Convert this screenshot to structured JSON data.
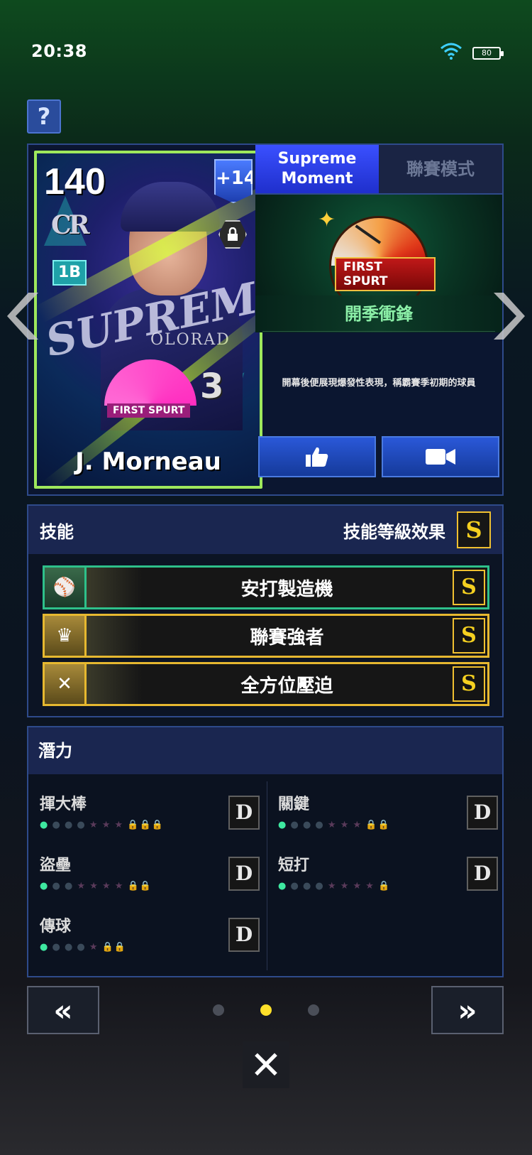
{
  "status_bar": {
    "time": "20:38",
    "battery": "80"
  },
  "help": {
    "label": "?"
  },
  "card": {
    "overall": "140",
    "plus": "+14",
    "team_logo": "CR",
    "position": "1B",
    "player_name": "J. Morneau",
    "jersey_text": "OLORAD",
    "jersey_number": "3",
    "overlay_word": "SUPREME",
    "theme_badge_label": "FIRST SPURT"
  },
  "tabs": [
    {
      "label": "Supreme\nMoment",
      "active": true
    },
    {
      "label": "聯賽模式",
      "active": false
    }
  ],
  "theme": {
    "badge_label": "FIRST SPURT",
    "title": "開季衝鋒",
    "description": "開幕後便展現爆發性表現，稱霸賽季初期的球員"
  },
  "skills": {
    "header_label": "技能",
    "level_effect_label": "技能等級效果",
    "level_grade": "S",
    "items": [
      {
        "name": "安打製造機",
        "grade": "S",
        "color": "#2ec08a"
      },
      {
        "name": "聯賽強者",
        "grade": "S",
        "color": "#e6b830"
      },
      {
        "name": "全方位壓迫",
        "grade": "S",
        "color": "#e6b830"
      }
    ]
  },
  "potential": {
    "header_label": "潛力",
    "items": [
      {
        "name": "揮大棒",
        "grade": "D",
        "dots_on": 1,
        "dots_off": 3,
        "stars": 3,
        "locks": 3
      },
      {
        "name": "關鍵",
        "grade": "D",
        "dots_on": 1,
        "dots_off": 3,
        "stars": 3,
        "locks": 2
      },
      {
        "name": "盜壘",
        "grade": "D",
        "dots_on": 1,
        "dots_off": 2,
        "stars": 4,
        "locks": 2
      },
      {
        "name": "短打",
        "grade": "D",
        "dots_on": 1,
        "dots_off": 3,
        "stars": 4,
        "locks": 1
      },
      {
        "name": "傳球",
        "grade": "D",
        "dots_on": 1,
        "dots_off": 3,
        "stars": 1,
        "locks": 2
      }
    ]
  },
  "pagination": {
    "current": 2,
    "total": 3
  },
  "nav": {
    "prev": "«",
    "next": "»",
    "close": "✕"
  },
  "colors": {
    "accent_blue": "#2a58d8",
    "skill_green": "#2ec08a",
    "gold": "#f0c030",
    "theme_green": "#8cf0a8"
  }
}
